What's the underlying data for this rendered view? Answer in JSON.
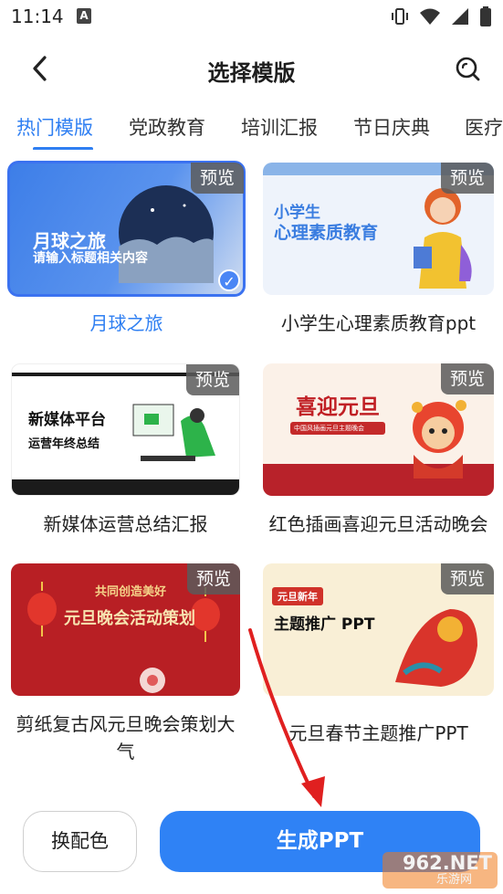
{
  "status": {
    "time": "11:14",
    "app_icon_letter": "A"
  },
  "header": {
    "title": "选择模版"
  },
  "tabs": [
    {
      "label": "热门模版",
      "active": true
    },
    {
      "label": "党政教育",
      "active": false
    },
    {
      "label": "培训汇报",
      "active": false
    },
    {
      "label": "节日庆典",
      "active": false
    },
    {
      "label": "医疗",
      "active": false
    }
  ],
  "templates": [
    {
      "label": "月球之旅",
      "preview": "预览",
      "selected": true,
      "thumb_title": "月球之旅",
      "thumb_sub": "请输入标题相关内容"
    },
    {
      "label": "小学生心理素质教育ppt",
      "preview": "预览",
      "selected": false,
      "thumb_title": "小学生",
      "thumb_sub": "心理素质教育"
    },
    {
      "label": "新媒体运营总结汇报",
      "preview": "预览",
      "selected": false,
      "thumb_title": "新媒体平台",
      "thumb_sub": "运营年终总结"
    },
    {
      "label": "红色插画喜迎元旦活动晚会",
      "preview": "预览",
      "selected": false,
      "thumb_title": "喜迎元旦",
      "thumb_sub": "中国风插画元旦主题晚会"
    },
    {
      "label": "剪纸复古风元旦晚会策划大气",
      "preview": "预览",
      "selected": false,
      "thumb_title": "元旦晚会活动策划",
      "thumb_sub": "共同创造美好"
    },
    {
      "label": "元旦春节主题推广PPT",
      "preview": "预览",
      "selected": false,
      "thumb_title": "主题推广 PPT",
      "thumb_sub": "元旦新年"
    }
  ],
  "buttons": {
    "color": "换配色",
    "generate": "生成PPT"
  },
  "watermark": {
    "text": "962.NET",
    "sub": "乐游网"
  },
  "colors": {
    "accent": "#2f7ff2",
    "generate_button": "#2f82f5",
    "arrow": "#e02020"
  }
}
